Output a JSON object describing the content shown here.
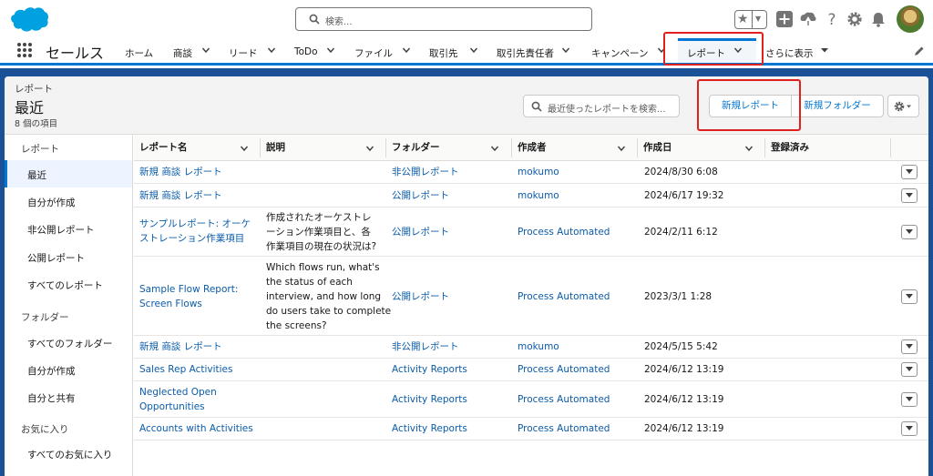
{
  "global_header": {
    "search_placeholder": "検索...",
    "logo": "salesforce-cloud-logo"
  },
  "app_nav": {
    "app_name": "セールス",
    "items": [
      {
        "label": "ホーム"
      },
      {
        "label": "商談"
      },
      {
        "label": "リード"
      },
      {
        "label": "ToDo"
      },
      {
        "label": "ファイル"
      },
      {
        "label": "取引先"
      },
      {
        "label": "取引先責任者"
      },
      {
        "label": "キャンペーン"
      },
      {
        "label": "レポート"
      },
      {
        "label": "さらに表示"
      }
    ]
  },
  "page_header": {
    "breadcrumb": "レポート",
    "title": "最近",
    "count": "8 個の項目",
    "search_placeholder": "最近使ったレポートを検索...",
    "new_report": "新規レポート",
    "new_folder": "新規フォルダー"
  },
  "sidebar": {
    "sections": [
      {
        "heading": "レポート",
        "items": [
          "最近",
          "自分が作成",
          "非公開レポート",
          "公開レポート",
          "すべてのレポート"
        ]
      },
      {
        "heading": "フォルダー",
        "items": [
          "すべてのフォルダー",
          "自分が作成",
          "自分と共有"
        ]
      },
      {
        "heading": "お気に入り",
        "items": [
          "すべてのお気に入り"
        ]
      }
    ],
    "active": "最近"
  },
  "table": {
    "columns": [
      "レポート名",
      "説明",
      "フォルダー",
      "作成者",
      "作成日",
      "登録済み"
    ],
    "rows": [
      {
        "name": [
          "新規 商談 レポート"
        ],
        "desc": [],
        "folder": "非公開レポート",
        "creator": "mokumo",
        "date": "2024/8/30 6:08"
      },
      {
        "name": [
          "新規 商談 レポート"
        ],
        "desc": [],
        "folder": "公開レポート",
        "creator": "mokumo",
        "date": "2024/6/17 19:32"
      },
      {
        "name": [
          "サンプルレポート: オーケ",
          "ストレーション作業項目"
        ],
        "desc": [
          "作成されたオーケストレ",
          "ーション作業項目と、各",
          "作業項目の現在の状況は?"
        ],
        "folder": "公開レポート",
        "creator": "Process Automated",
        "date": "2024/2/11 6:12"
      },
      {
        "name": [
          "Sample Flow Report:",
          "Screen Flows"
        ],
        "desc": [
          "Which flows run, what's",
          "the status of each",
          "interview, and how long",
          "do users take to complete",
          "the screens?"
        ],
        "folder": "公開レポート",
        "creator": "Process Automated",
        "date": "2023/3/1 1:28"
      },
      {
        "name": [
          "新規 商談 レポート"
        ],
        "desc": [],
        "folder": "非公開レポート",
        "creator": "mokumo",
        "date": "2024/5/15 5:42"
      },
      {
        "name": [
          "Sales Rep Activities"
        ],
        "desc": [],
        "folder": "Activity Reports",
        "creator": "Process Automated",
        "date": "2024/6/12 13:19"
      },
      {
        "name": [
          "Neglected Open",
          "Opportunities"
        ],
        "desc": [],
        "folder": "Activity Reports",
        "creator": "Process Automated",
        "date": "2024/6/12 13:19"
      },
      {
        "name": [
          "Accounts with Activities"
        ],
        "desc": [],
        "folder": "Activity Reports",
        "creator": "Process Automated",
        "date": "2024/6/12 13:19"
      }
    ]
  },
  "colors": {
    "brand_blue": "#0176d3",
    "link_blue": "#0b5cab",
    "highlight_red": "#e0201f",
    "page_background": "#1b5297"
  }
}
